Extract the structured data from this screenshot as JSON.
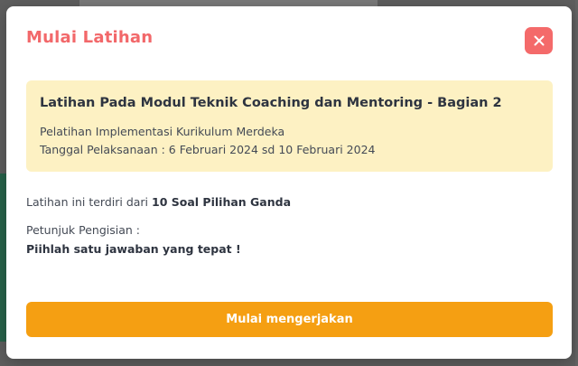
{
  "modal": {
    "title": "Mulai Latihan",
    "close_icon": "close-icon",
    "info": {
      "title": "Latihan Pada Modul Teknik Coaching dan Mentoring - Bagian 2",
      "course": "Pelatihan Implementasi Kurikulum Merdeka",
      "schedule": "Tanggal Pelaksanaan : 6 Februari 2024 sd 10 Februari 2024"
    },
    "summary_prefix": "Latihan ini terdiri dari ",
    "summary_count": "10 Soal Pilihan Ganda",
    "instructions_label": "Petunjuk Pengisian :",
    "instructions_text": "Piihlah satu jawaban yang tepat !",
    "start_button_label": "Mulai mengerjakan"
  },
  "colors": {
    "title": "#f2686a",
    "close_button": "#f46a6a",
    "info_background": "#fdf1c3",
    "start_button": "#f59f12"
  }
}
